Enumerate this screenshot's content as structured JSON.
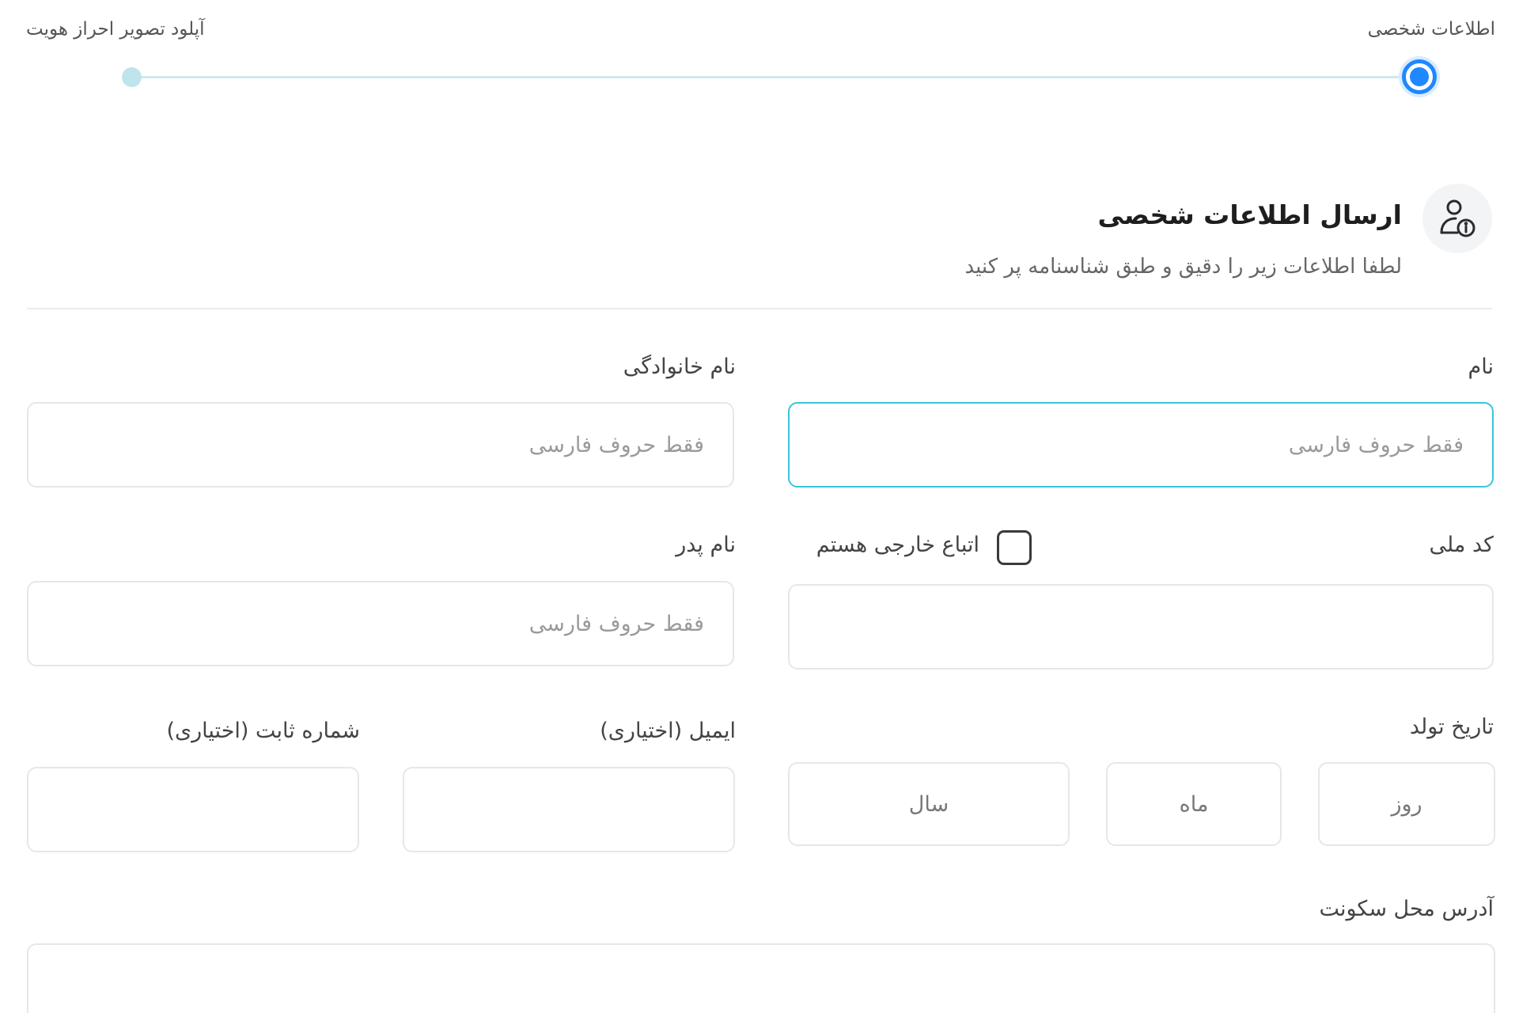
{
  "stepper": {
    "steps": [
      {
        "label": "اطلاعات شخصی",
        "active": true
      },
      {
        "label": "آپلود تصویر احراز هویت",
        "active": false
      }
    ],
    "active_color": "#1f87ff",
    "inactive_color": "#bfe4ec"
  },
  "section": {
    "icon": "user-info-icon",
    "title": "ارسال اطلاعات شخصی",
    "subtitle": "لطفا اطلاعات زیر را دقیق و طبق شناسنامه پر کنید"
  },
  "form": {
    "first_name": {
      "label": "نام",
      "placeholder": "فقط حروف فارسی",
      "value": ""
    },
    "last_name": {
      "label": "نام خانوادگی",
      "placeholder": "فقط حروف فارسی",
      "value": ""
    },
    "national_code": {
      "label": "کد ملی",
      "placeholder": "",
      "value": ""
    },
    "foreign_national": {
      "label": "اتباع خارجی هستم",
      "checked": false
    },
    "father_name": {
      "label": "نام پدر",
      "placeholder": "فقط حروف فارسی",
      "value": ""
    },
    "birth_date": {
      "label": "تاریخ تولد",
      "day_placeholder": "روز",
      "month_placeholder": "ماه",
      "year_placeholder": "سال"
    },
    "email": {
      "label": "ایمیل (اختیاری)",
      "placeholder": "",
      "value": ""
    },
    "landline": {
      "label": "شماره ثابت (اختیاری)",
      "placeholder": "",
      "value": ""
    },
    "address": {
      "label": "آدرس محل سکونت",
      "placeholder": "",
      "value": ""
    }
  },
  "colors": {
    "focus_border": "#39c5d8",
    "field_border": "#e3e8ea"
  }
}
